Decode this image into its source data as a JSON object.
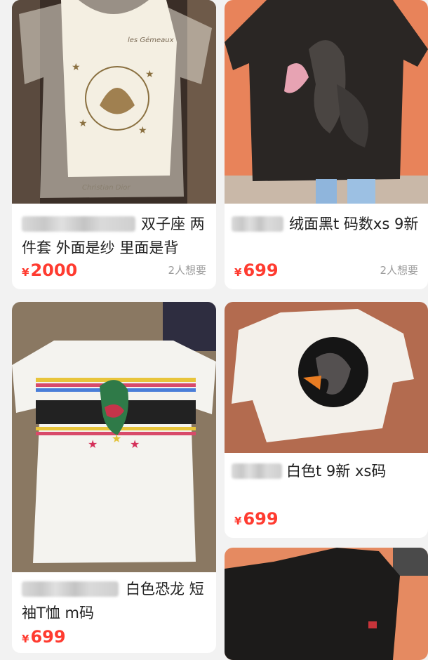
{
  "products": [
    {
      "title": "双子座 两件套 外面是纱 里面是背",
      "price": "2000",
      "currency": "¥",
      "wants": "2人想要",
      "image_icon": "tshirt-gemini-image"
    },
    {
      "title": "绒面黑t 码数xs 9新",
      "price": "699",
      "currency": "¥",
      "wants": "2人想要",
      "image_icon": "tshirt-flamingo-black-image"
    },
    {
      "title": "白色恐龙 短袖T恤 m码",
      "price": "699",
      "currency": "¥",
      "image_icon": "tshirt-dinosaur-image"
    },
    {
      "title": "白色t 9新 xs码",
      "price": "699",
      "currency": "¥",
      "image_icon": "tshirt-swan-white-image"
    },
    {
      "image_icon": "tshirt-black-partial-image"
    }
  ],
  "colors": {
    "price": "#ff3b30",
    "muted": "#9a9a9a",
    "background": "#f2f2f2"
  }
}
